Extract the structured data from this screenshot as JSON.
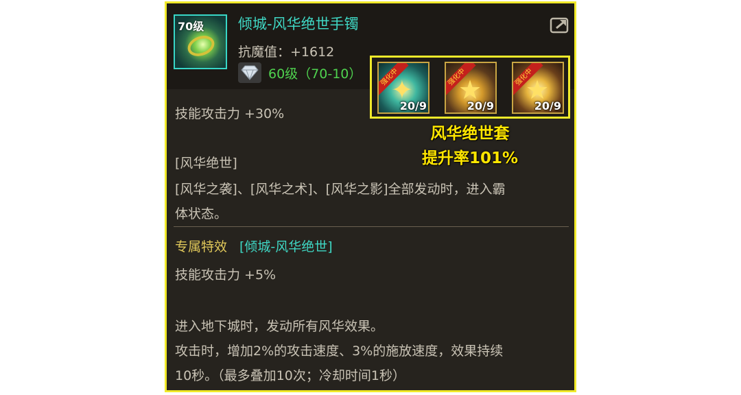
{
  "item": {
    "level_badge": "70级",
    "name": "倾城-风华绝世手镯",
    "stat": "抗魔值：+1612",
    "level_req": "60级（70-10）"
  },
  "set": {
    "items": [
      {
        "ribbon": "强化中",
        "count": "20/9"
      },
      {
        "ribbon": "强化中",
        "count": "20/9"
      },
      {
        "ribbon": "强化中",
        "count": "20/9"
      }
    ],
    "title": "风华绝世套",
    "rate": "提升率101%"
  },
  "desc": {
    "skill_atk": "技能攻击力 +30%",
    "set_tag": "[风华绝世]",
    "set_effect_line1": "[风华之袭]、[风华之术]、[风华之影]全部发动时，进入霸",
    "set_effect_line2": "体状态。"
  },
  "special": {
    "label": "专属特效",
    "name": "[倾城-风华绝世]",
    "skill_atk": "技能攻击力 +5%",
    "line1": "进入地下城时，发动所有风华效果。",
    "line2": "攻击时，增加2%的攻击速度、3%的施放速度，效果持续",
    "line3": "10秒。（最多叠加10次；冷却时间1秒）"
  },
  "colors": {
    "highlight_border": "#f1ea2a",
    "item_name": "#3fd7c4",
    "level_req": "#4fd24f",
    "set_text": "#ffe600"
  },
  "icons": [
    "bracelet-item-icon",
    "share-icon",
    "diamond-icon",
    "set-item-icon"
  ]
}
